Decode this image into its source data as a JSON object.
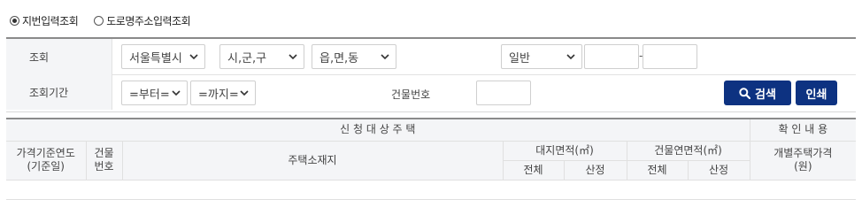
{
  "mode": {
    "options": [
      {
        "label": "지번입력조회",
        "selected": true
      },
      {
        "label": "도로명주소입력조회",
        "selected": false
      }
    ]
  },
  "search": {
    "row1_label": "조회",
    "row2_label": "조회기간",
    "sido": "서울특별시",
    "sigungu": "시,군,구",
    "dong": "읍,면,동",
    "land_type": "일반",
    "bunji_main": "",
    "bunji_sub": "",
    "bunji_dash": "-",
    "period_from": "=부터=",
    "period_to": "=까지=",
    "building_no_label": "건물번호",
    "building_no": "",
    "search_button": "검색",
    "print_button": "인쇄"
  },
  "table": {
    "group_target": "신 청 대 상 주 택",
    "group_confirm": "확 인 내 용",
    "col_price_year": "가격기준연도\n(기준일)",
    "col_building_no": "건물\n번호",
    "col_address": "주택소재지",
    "col_land_area": "대지면적(㎡)",
    "col_building_area": "건물연면적(㎡)",
    "col_price": "개별주택가격\n(원)",
    "sub_total": "전체",
    "sub_calc": "산정",
    "rows": []
  },
  "colors": {
    "accent": "#0d3281",
    "header_bg": "#f4f5f7",
    "border": "#e0e0e0"
  }
}
